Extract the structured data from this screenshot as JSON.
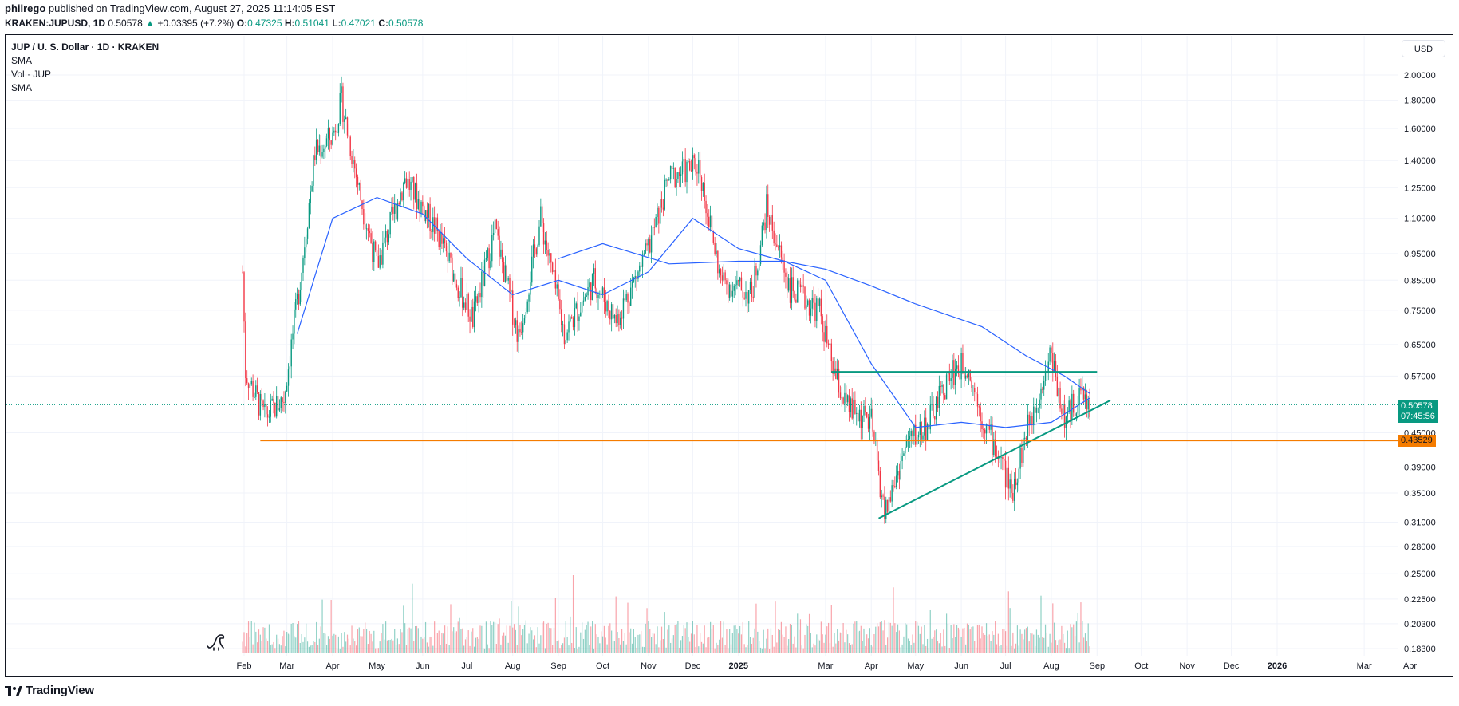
{
  "header": {
    "user": "philrego",
    "published": "published on TradingView.com, August 27, 2025 11:14:05 EST",
    "symbol": "KRAKEN:JUPUSD, 1D",
    "last": "0.50578",
    "change": "+0.03395 (+7.2%)",
    "o_label": "O:",
    "o": "0.47325",
    "h_label": "H:",
    "h": "0.51041",
    "l_label": "L:",
    "l": "0.47021",
    "c_label": "C:",
    "c": "0.50578"
  },
  "legend": {
    "title": "JUP / U. S. Dollar · 1D · KRAKEN",
    "line1": "SMA",
    "line2": "Vol · JUP",
    "line3": "SMA"
  },
  "currency_button": "USD",
  "price_tags": {
    "last": "0.50578",
    "countdown": "07:45:56",
    "support": "0.43529"
  },
  "footer": {
    "brand": "TradingView"
  },
  "colors": {
    "up": "#089981",
    "down": "#f23645",
    "sma": "#2962ff",
    "trendline": "#089981",
    "support": "#f57c00"
  },
  "chart_data": {
    "type": "line",
    "yscale": "log",
    "y_ticks": [
      "2.00000",
      "1.80000",
      "1.60000",
      "1.40000",
      "1.25000",
      "1.10000",
      "0.95000",
      "0.85000",
      "0.75000",
      "0.65000",
      "0.57000",
      "0.45000",
      "0.39000",
      "0.35000",
      "0.31000",
      "0.28000",
      "0.25000",
      "0.22500",
      "0.20300",
      "0.18300"
    ],
    "x_ticks": [
      "Feb",
      "Mar",
      "Apr",
      "May",
      "Jun",
      "Jul",
      "Aug",
      "Sep",
      "Oct",
      "Nov",
      "Dec",
      "2025",
      "Mar",
      "Apr",
      "May",
      "Jun",
      "Jul",
      "Aug",
      "Sep",
      "Oct",
      "Nov",
      "Dec",
      "2026",
      "Mar",
      "Apr"
    ],
    "price_path": [
      {
        "date": "2024-01-31",
        "price": 0.88
      },
      {
        "date": "2024-02-02",
        "price": 0.58
      },
      {
        "date": "2024-02-15",
        "price": 0.48
      },
      {
        "date": "2024-02-28",
        "price": 0.52
      },
      {
        "date": "2024-03-10",
        "price": 0.85
      },
      {
        "date": "2024-03-20",
        "price": 1.45
      },
      {
        "date": "2024-04-01",
        "price": 1.55
      },
      {
        "date": "2024-04-07",
        "price": 1.8
      },
      {
        "date": "2024-04-20",
        "price": 1.2
      },
      {
        "date": "2024-05-01",
        "price": 0.9
      },
      {
        "date": "2024-05-20",
        "price": 1.3
      },
      {
        "date": "2024-06-10",
        "price": 1.05
      },
      {
        "date": "2024-07-05",
        "price": 0.72
      },
      {
        "date": "2024-07-20",
        "price": 1.05
      },
      {
        "date": "2024-08-05",
        "price": 0.67
      },
      {
        "date": "2024-08-20",
        "price": 1.1
      },
      {
        "date": "2024-09-05",
        "price": 0.68
      },
      {
        "date": "2024-09-25",
        "price": 0.85
      },
      {
        "date": "2024-10-10",
        "price": 0.72
      },
      {
        "date": "2024-10-31",
        "price": 0.95
      },
      {
        "date": "2024-11-15",
        "price": 1.3
      },
      {
        "date": "2024-12-05",
        "price": 1.38
      },
      {
        "date": "2024-12-20",
        "price": 0.85
      },
      {
        "date": "2025-01-10",
        "price": 0.8
      },
      {
        "date": "2025-01-20",
        "price": 1.15
      },
      {
        "date": "2025-02-05",
        "price": 0.82
      },
      {
        "date": "2025-02-25",
        "price": 0.75
      },
      {
        "date": "2025-03-05",
        "price": 0.6
      },
      {
        "date": "2025-03-15",
        "price": 0.5
      },
      {
        "date": "2025-04-01",
        "price": 0.47
      },
      {
        "date": "2025-04-10",
        "price": 0.32
      },
      {
        "date": "2025-04-25",
        "price": 0.43
      },
      {
        "date": "2025-05-10",
        "price": 0.47
      },
      {
        "date": "2025-05-25",
        "price": 0.58
      },
      {
        "date": "2025-06-05",
        "price": 0.6
      },
      {
        "date": "2025-06-15",
        "price": 0.48
      },
      {
        "date": "2025-06-28",
        "price": 0.4
      },
      {
        "date": "2025-07-05",
        "price": 0.35
      },
      {
        "date": "2025-07-15",
        "price": 0.45
      },
      {
        "date": "2025-07-25",
        "price": 0.55
      },
      {
        "date": "2025-08-01",
        "price": 0.63
      },
      {
        "date": "2025-08-10",
        "price": 0.47
      },
      {
        "date": "2025-08-20",
        "price": 0.53
      },
      {
        "date": "2025-08-27",
        "price": 0.50578
      }
    ],
    "sma_long": [
      {
        "date": "2024-09-01",
        "price": 0.93
      },
      {
        "date": "2024-10-01",
        "price": 0.99
      },
      {
        "date": "2024-11-15",
        "price": 0.91
      },
      {
        "date": "2025-01-01",
        "price": 0.92
      },
      {
        "date": "2025-02-01",
        "price": 0.92
      },
      {
        "date": "2025-03-01",
        "price": 0.89
      },
      {
        "date": "2025-04-01",
        "price": 0.83
      },
      {
        "date": "2025-05-01",
        "price": 0.77
      },
      {
        "date": "2025-06-15",
        "price": 0.7
      },
      {
        "date": "2025-07-15",
        "price": 0.62
      },
      {
        "date": "2025-08-10",
        "price": 0.57
      },
      {
        "date": "2025-08-27",
        "price": 0.53
      }
    ],
    "sma_short": [
      {
        "date": "2024-03-08",
        "price": 0.68
      },
      {
        "date": "2024-04-01",
        "price": 1.1
      },
      {
        "date": "2024-05-01",
        "price": 1.2
      },
      {
        "date": "2024-06-01",
        "price": 1.12
      },
      {
        "date": "2024-07-01",
        "price": 0.93
      },
      {
        "date": "2024-08-01",
        "price": 0.8
      },
      {
        "date": "2024-09-01",
        "price": 0.85
      },
      {
        "date": "2024-10-01",
        "price": 0.8
      },
      {
        "date": "2024-11-01",
        "price": 0.88
      },
      {
        "date": "2024-12-01",
        "price": 1.1
      },
      {
        "date": "2025-01-01",
        "price": 0.97
      },
      {
        "date": "2025-02-01",
        "price": 0.92
      },
      {
        "date": "2025-03-01",
        "price": 0.85
      },
      {
        "date": "2025-04-01",
        "price": 0.6
      },
      {
        "date": "2025-05-01",
        "price": 0.46
      },
      {
        "date": "2025-06-01",
        "price": 0.47
      },
      {
        "date": "2025-07-01",
        "price": 0.46
      },
      {
        "date": "2025-08-01",
        "price": 0.47
      },
      {
        "date": "2025-08-27",
        "price": 0.52
      }
    ],
    "horizontal_resistance": {
      "from": "2025-03-05",
      "to": "2025-09-01",
      "price": 0.58
    },
    "rising_trendline": {
      "from": {
        "date": "2025-04-06",
        "price": 0.315
      },
      "to": {
        "date": "2025-09-10",
        "price": 0.515
      }
    },
    "support_line": {
      "from": "2024-02-12",
      "price": 0.43529
    }
  }
}
